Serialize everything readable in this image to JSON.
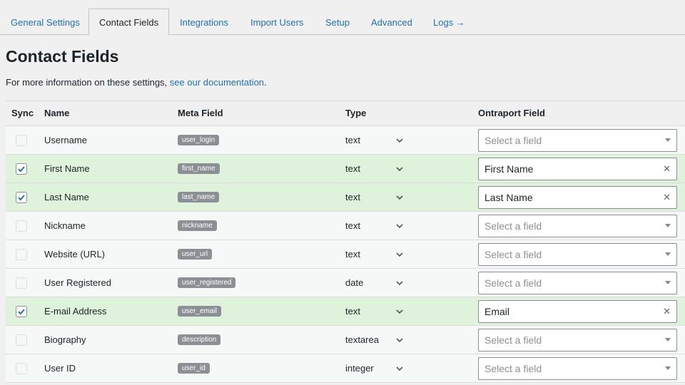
{
  "tabs": [
    {
      "label": "General Settings",
      "active": false
    },
    {
      "label": "Contact Fields",
      "active": true
    },
    {
      "label": "Integrations",
      "active": false
    },
    {
      "label": "Import Users",
      "active": false
    },
    {
      "label": "Setup",
      "active": false
    },
    {
      "label": "Advanced",
      "active": false
    },
    {
      "label": "Logs →",
      "active": false
    }
  ],
  "page": {
    "title": "Contact Fields",
    "info_text": "For more information on these settings, ",
    "info_link": "see our documentation",
    "info_end": "."
  },
  "table": {
    "headers": {
      "sync": "Sync",
      "name": "Name",
      "meta": "Meta Field",
      "type": "Type",
      "ontraport": "Ontraport Field"
    },
    "placeholder": "Select a field",
    "rows": [
      {
        "sync": false,
        "name": "Username",
        "meta": "user_login",
        "type": "text",
        "ontraport": ""
      },
      {
        "sync": true,
        "name": "First Name",
        "meta": "first_name",
        "type": "text",
        "ontraport": "First Name"
      },
      {
        "sync": true,
        "name": "Last Name",
        "meta": "last_name",
        "type": "text",
        "ontraport": "Last Name"
      },
      {
        "sync": false,
        "name": "Nickname",
        "meta": "nickname",
        "type": "text",
        "ontraport": ""
      },
      {
        "sync": false,
        "name": "Website (URL)",
        "meta": "user_url",
        "type": "text",
        "ontraport": ""
      },
      {
        "sync": false,
        "name": "User Registered",
        "meta": "user_registered",
        "type": "date",
        "ontraport": ""
      },
      {
        "sync": true,
        "name": "E-mail Address",
        "meta": "user_email",
        "type": "text",
        "ontraport": "Email"
      },
      {
        "sync": false,
        "name": "Biography",
        "meta": "description",
        "type": "textarea",
        "ontraport": ""
      },
      {
        "sync": false,
        "name": "User ID",
        "meta": "user_id",
        "type": "integer",
        "ontraport": ""
      }
    ]
  },
  "colors": {
    "link": "#2271b1",
    "synced_row": "#def2dc",
    "checkbox": "#2271b1"
  }
}
